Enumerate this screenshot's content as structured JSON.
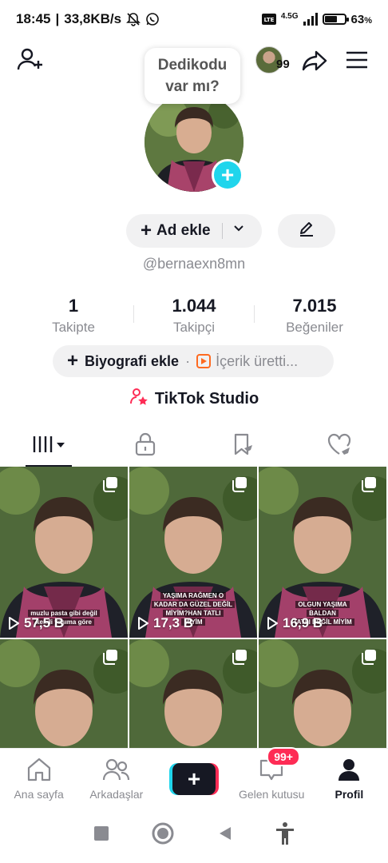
{
  "status_bar": {
    "time": "18:45",
    "speed": "33,8KB/s",
    "network": "4.5G",
    "battery": "63",
    "battery_unit": "%",
    "battery_level": 0.63,
    "icons": [
      "mute-bell-icon",
      "whatsapp-icon",
      "volte-icon",
      "signal-icon",
      "battery-icon"
    ]
  },
  "topbar": {
    "friends_count": "99",
    "icons": [
      "add-user-icon",
      "share-icon",
      "menu-icon"
    ]
  },
  "bubble": {
    "line1": "Dedikodu",
    "line2": "var mı?"
  },
  "profile": {
    "username": "@bernaexn8mn",
    "add_name_label": "Ad ekle",
    "add_bio_label": "Biyografi ekle",
    "bio_separator": "·",
    "creator_label": "İçerik üretti..."
  },
  "stats": [
    {
      "value": "1",
      "label": "Takipte"
    },
    {
      "value": "1.044",
      "label": "Takipçi"
    },
    {
      "value": "7.015",
      "label": "Beğeniler"
    }
  ],
  "studio": {
    "label": "TikTok Studio"
  },
  "tabs": [
    {
      "name": "videos",
      "icon": "grid-icon",
      "active": true
    },
    {
      "name": "private",
      "icon": "lock-icon",
      "active": false
    },
    {
      "name": "favorites",
      "icon": "bookmark-icon",
      "active": false
    },
    {
      "name": "liked",
      "icon": "heart-icon",
      "active": false
    }
  ],
  "videos": [
    {
      "views": "57,5 B",
      "caption": [
        "muzlu pasta gibi değil",
        "kendi yaşıma göre"
      ]
    },
    {
      "views": "17,3 B",
      "caption": [
        "YAŞIMA RAĞMEN O",
        "KADAR DA GÜZEL DEĞİL",
        "MİYİM?HAN TATLI",
        "MİYİM"
      ]
    },
    {
      "views": "16,9 B",
      "caption": [
        "OLGUN YAŞIMA",
        "BALDAN",
        "TATLI DEĞİL MİYİM"
      ]
    },
    {
      "views": "",
      "caption": []
    },
    {
      "views": "",
      "caption": []
    },
    {
      "views": "",
      "caption": []
    }
  ],
  "bottom_nav": {
    "items": [
      {
        "label": "Ana sayfa",
        "icon": "home-icon"
      },
      {
        "label": "Arkadaşlar",
        "icon": "friends-icon"
      },
      {
        "label": "",
        "icon": "create-plus-icon"
      },
      {
        "label": "Gelen kutusu",
        "icon": "inbox-icon",
        "badge": "99+"
      },
      {
        "label": "Profil",
        "icon": "profile-icon",
        "active": true
      }
    ]
  },
  "colors": {
    "accent_red": "#fe2c55",
    "accent_cyan": "#20d5ec",
    "text_primary": "#161823",
    "text_secondary": "#8a8b91"
  }
}
